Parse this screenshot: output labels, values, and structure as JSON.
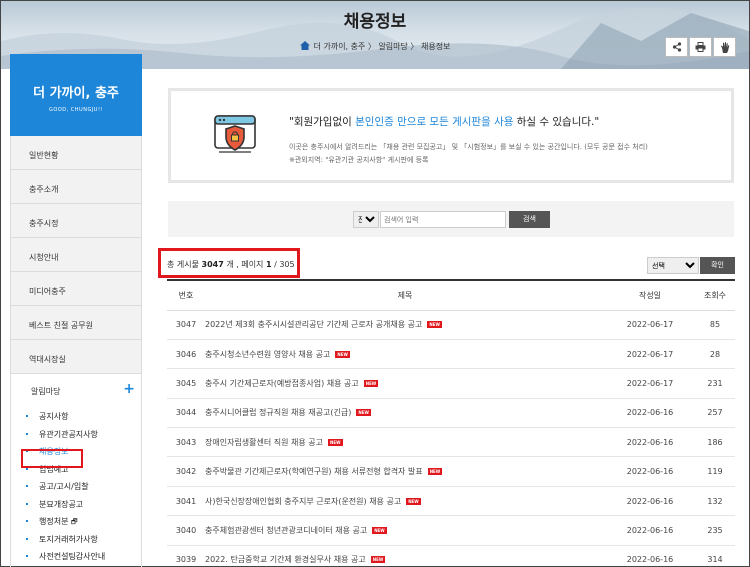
{
  "header": {
    "page_title": "채용정보",
    "breadcrumb": "더 가까이, 충주 〉 알림마당 〉 채용정보",
    "home_icon": "home-icon",
    "tools": [
      "share-icon",
      "print-icon",
      "hand-icon"
    ]
  },
  "sidebar": {
    "title": "더 가까이, 충주",
    "subtitle": "GOOD, CHUNGJU!!",
    "items": [
      {
        "label": "일반현황"
      },
      {
        "label": "충주소개"
      },
      {
        "label": "충주시정"
      },
      {
        "label": "시청안내"
      },
      {
        "label": "미디어충주"
      },
      {
        "label": "베스트 친절 공무원"
      },
      {
        "label": "역대시장실"
      }
    ],
    "open_section": {
      "label": "알림마당",
      "toggle": "+",
      "sub_items": [
        {
          "label": "공지사항"
        },
        {
          "label": "유관기관공지사항"
        },
        {
          "label": "채용정보"
        },
        {
          "label": "입법예고"
        },
        {
          "label": "공고/고시/입찰"
        },
        {
          "label": "분묘개장공고"
        },
        {
          "label": "행정처분"
        },
        {
          "label": "토지거래허가사항"
        },
        {
          "label": "사전컨설팅감사안내"
        }
      ]
    }
  },
  "notice": {
    "msg_a": "\"회원가입없이 ",
    "msg_b": "본인인증 만으로 모든 게시판을 사용",
    "msg_c": " 하실 수 있습니다.\"",
    "desc1": "이곳은 충주시에서 알려드리는 「채용 관련 모집공고」 및 「시험정보」를 보실 수 있는 공간입니다. (모두 공문 접수 처리)",
    "desc2": "※관외지역: \"유관기관 공지사항\" 게시판에 등록"
  },
  "search": {
    "scope": "전체",
    "placeholder": "검색어 입력",
    "button": "검색"
  },
  "listing": {
    "count_prefix": "총 게시물 ",
    "count_value": "3047",
    "count_suffix": " 개 ,  페이지 ",
    "page_current": "1",
    "page_total": " / 305",
    "sort_placeholder": "선택",
    "confirm_button": "확인",
    "columns": [
      "번호",
      "제목",
      "작성일",
      "조회수"
    ],
    "new_badge": "NEW",
    "rows": [
      {
        "no": "3047",
        "title": "2022년 제3회 충주시시설관리공단 기간제 근로자 공개채용 공고",
        "date": "2022-06-17",
        "views": "85"
      },
      {
        "no": "3046",
        "title": "충주시청소년수련원 영양사 채용 공고",
        "date": "2022-06-17",
        "views": "28"
      },
      {
        "no": "3045",
        "title": "충주시 기간제근로자(예방접종사업) 채용 공고",
        "date": "2022-06-17",
        "views": "231"
      },
      {
        "no": "3044",
        "title": "충주시니어클럽 정규직원 채용 재공고(긴급)",
        "date": "2022-06-16",
        "views": "257"
      },
      {
        "no": "3043",
        "title": "장애인자립생활센터 직원 채용 공고",
        "date": "2022-06-16",
        "views": "186"
      },
      {
        "no": "3042",
        "title": "충주박물관 기간제근로자(학예연구원) 채용 서류전형 합격자 발표",
        "date": "2022-06-16",
        "views": "119"
      },
      {
        "no": "3041",
        "title": "사)한국신장장애인협회 충주지부 근로자(운전원) 채용 공고",
        "date": "2022-06-16",
        "views": "132"
      },
      {
        "no": "3040",
        "title": "충주체험관광센터 청년관광코디네이터 채용 공고",
        "date": "2022-06-16",
        "views": "235"
      },
      {
        "no": "3039",
        "title": "2022. 탄금중학교 기간제 환경실무사 채용 공고",
        "date": "2022-06-16",
        "views": "314"
      }
    ]
  }
}
